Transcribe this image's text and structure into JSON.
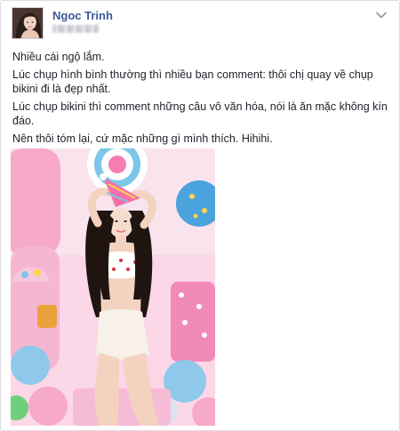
{
  "post": {
    "author": {
      "name": "Ngoc Trinh"
    },
    "body": {
      "lines": [
        "Nhiều cái ngộ lắm.",
        "Lúc chụp hình bình thường thì nhiều bạn comment: thôi chị quay về chụp bikini đi là đẹp nhất.",
        "Lúc chụp bikini thì comment những câu vô văn hóa, nói là ăn mặc không kín đáo.",
        "Nên thôi tóm lại, cứ mặc những gì mình thích. Hihihi."
      ]
    },
    "icons": {
      "options": "chevron-down-icon",
      "avatar": "profile-photo"
    },
    "colors": {
      "name_link": "#3b5998",
      "text": "#1d2129",
      "border": "#dddfe2"
    }
  }
}
